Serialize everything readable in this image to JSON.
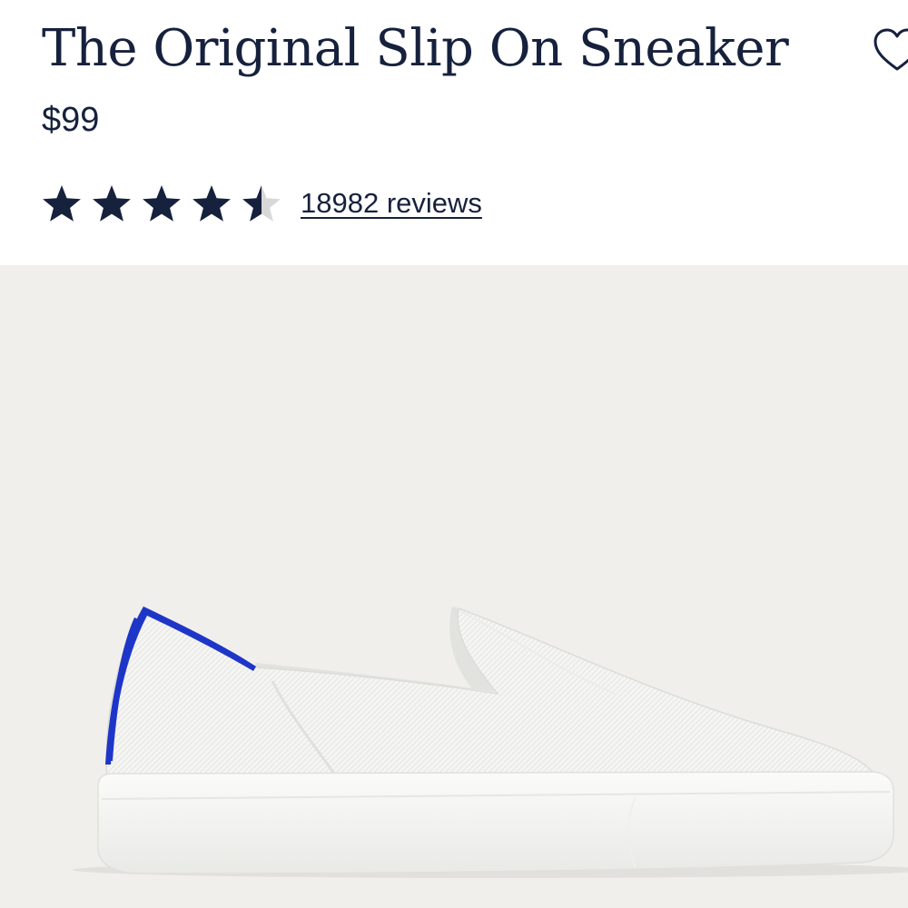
{
  "product": {
    "title": "The Original Slip On Sneaker",
    "price": "$99",
    "rating": 4.5,
    "rating_max": 5,
    "reviews_label": "18982 reviews"
  },
  "icons": {
    "wishlist": "heart-outline-icon",
    "rating": "star-icon"
  },
  "colors": {
    "text": "#16213d",
    "star_filled": "#16213d",
    "star_empty": "#d8d8d8",
    "image_background": "#f1efeb",
    "shoe_body": "#f7f7f5",
    "heel_accent": "#1e36c8"
  },
  "image": {
    "alt": "white knit slip-on sneaker with blue heel stripe"
  }
}
